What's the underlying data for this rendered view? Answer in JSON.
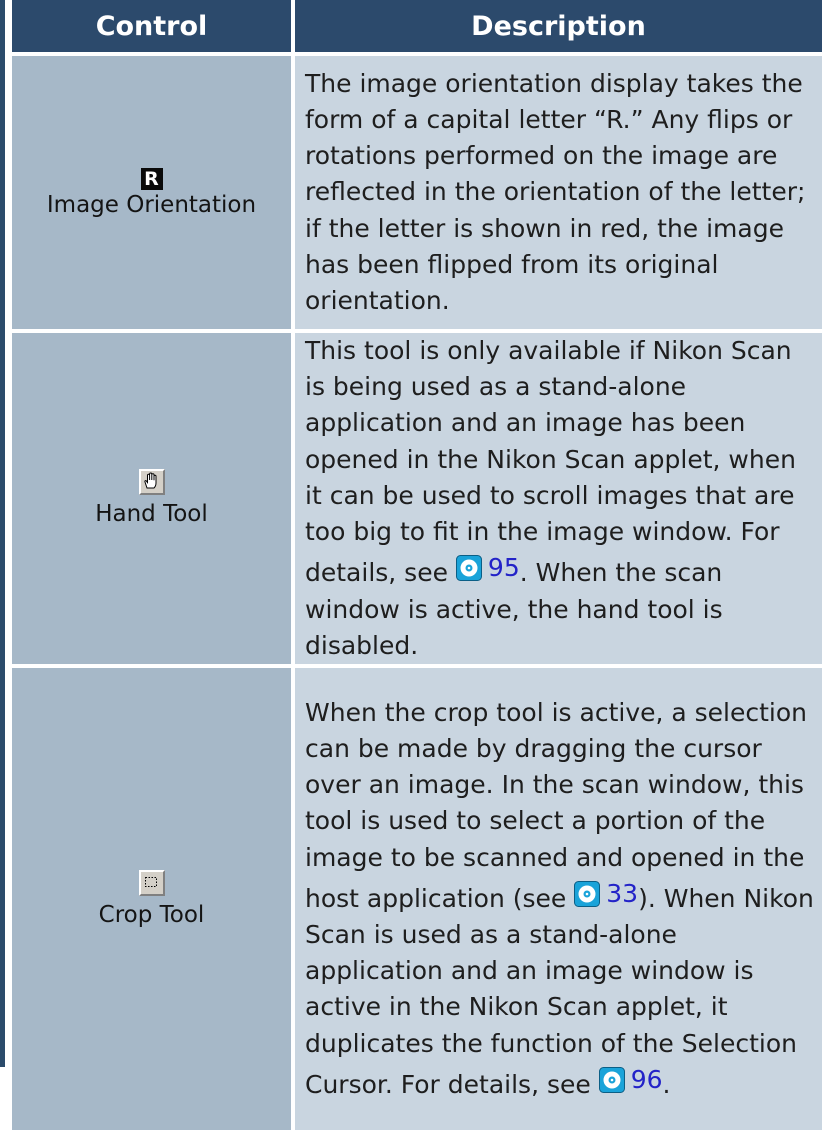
{
  "table": {
    "header": {
      "control": "Control",
      "description": "Description"
    },
    "rows": [
      {
        "control_name": "Image Orientation",
        "icon": "r-orientation-icon",
        "icon_text": "R",
        "description": "The image orientation display takes the form of a capital letter “R.”  Any flips or rotations performed on the image are reflected in the orientation of the letter; if the letter is shown in red, the image has been flipped from its original orientation."
      },
      {
        "control_name": "Hand Tool",
        "icon": "hand-icon",
        "description_before": "This tool is only available if Nikon Scan is being used as a stand-alone application and an image has been opened in the Nikon Scan applet, when it can be used to scroll images that are too big to fit in the image window.  For details, see ",
        "ref_page": "95",
        "description_after": ".  When the scan window is active, the hand tool is disabled."
      },
      {
        "control_name": "Crop Tool",
        "icon": "crop-marquee-icon",
        "description_before": "When the crop tool is active, a selection can be made by dragging the cursor over an image.  In the scan window, this tool is used to select a portion of the image to be scanned and opened in the host application (see ",
        "ref_page": "33",
        "description_middle": ").  When Nikon Scan is used as a stand-alone application and an image window is active in the Nikon Scan applet, it duplicates the function of the Selection Cursor.  For details, see ",
        "ref_page_2": "96",
        "description_after": "."
      }
    ]
  },
  "colors": {
    "header_bg": "#2c4a6c",
    "control_cell_bg": "#a6b8c8",
    "description_cell_bg": "#c9d5e0",
    "link": "#2323c8",
    "cd_icon": "#1aa3d9"
  }
}
